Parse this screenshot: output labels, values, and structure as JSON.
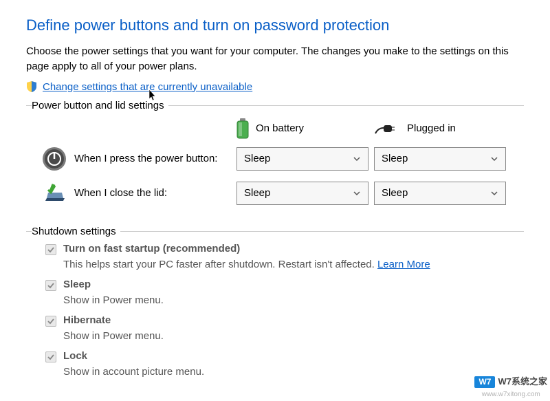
{
  "title": "Define power buttons and turn on password protection",
  "intro": "Choose the power settings that you want for your computer. The changes you make to the settings on this page apply to all of your power plans.",
  "change_link": "Change settings that are currently unavailable",
  "power_button_lid": {
    "legend": "Power button and lid settings",
    "on_battery_label": "On battery",
    "plugged_in_label": "Plugged in",
    "power_button_label": "When I press the power button:",
    "close_lid_label": "When I close the lid:",
    "power_button_battery": "Sleep",
    "power_button_plugged": "Sleep",
    "close_lid_battery": "Sleep",
    "close_lid_plugged": "Sleep"
  },
  "shutdown": {
    "legend": "Shutdown settings",
    "fast_startup_title": "Turn on fast startup (recommended)",
    "fast_startup_desc": "This helps start your PC faster after shutdown. Restart isn't affected. ",
    "learn_more": "Learn More",
    "sleep_title": "Sleep",
    "sleep_desc": "Show in Power menu.",
    "hibernate_title": "Hibernate",
    "hibernate_desc": "Show in Power menu.",
    "lock_title": "Lock",
    "lock_desc": "Show in account picture menu."
  },
  "watermark": {
    "badge": "W7",
    "text": "W7系统之家",
    "url": "www.w7xitong.com"
  }
}
